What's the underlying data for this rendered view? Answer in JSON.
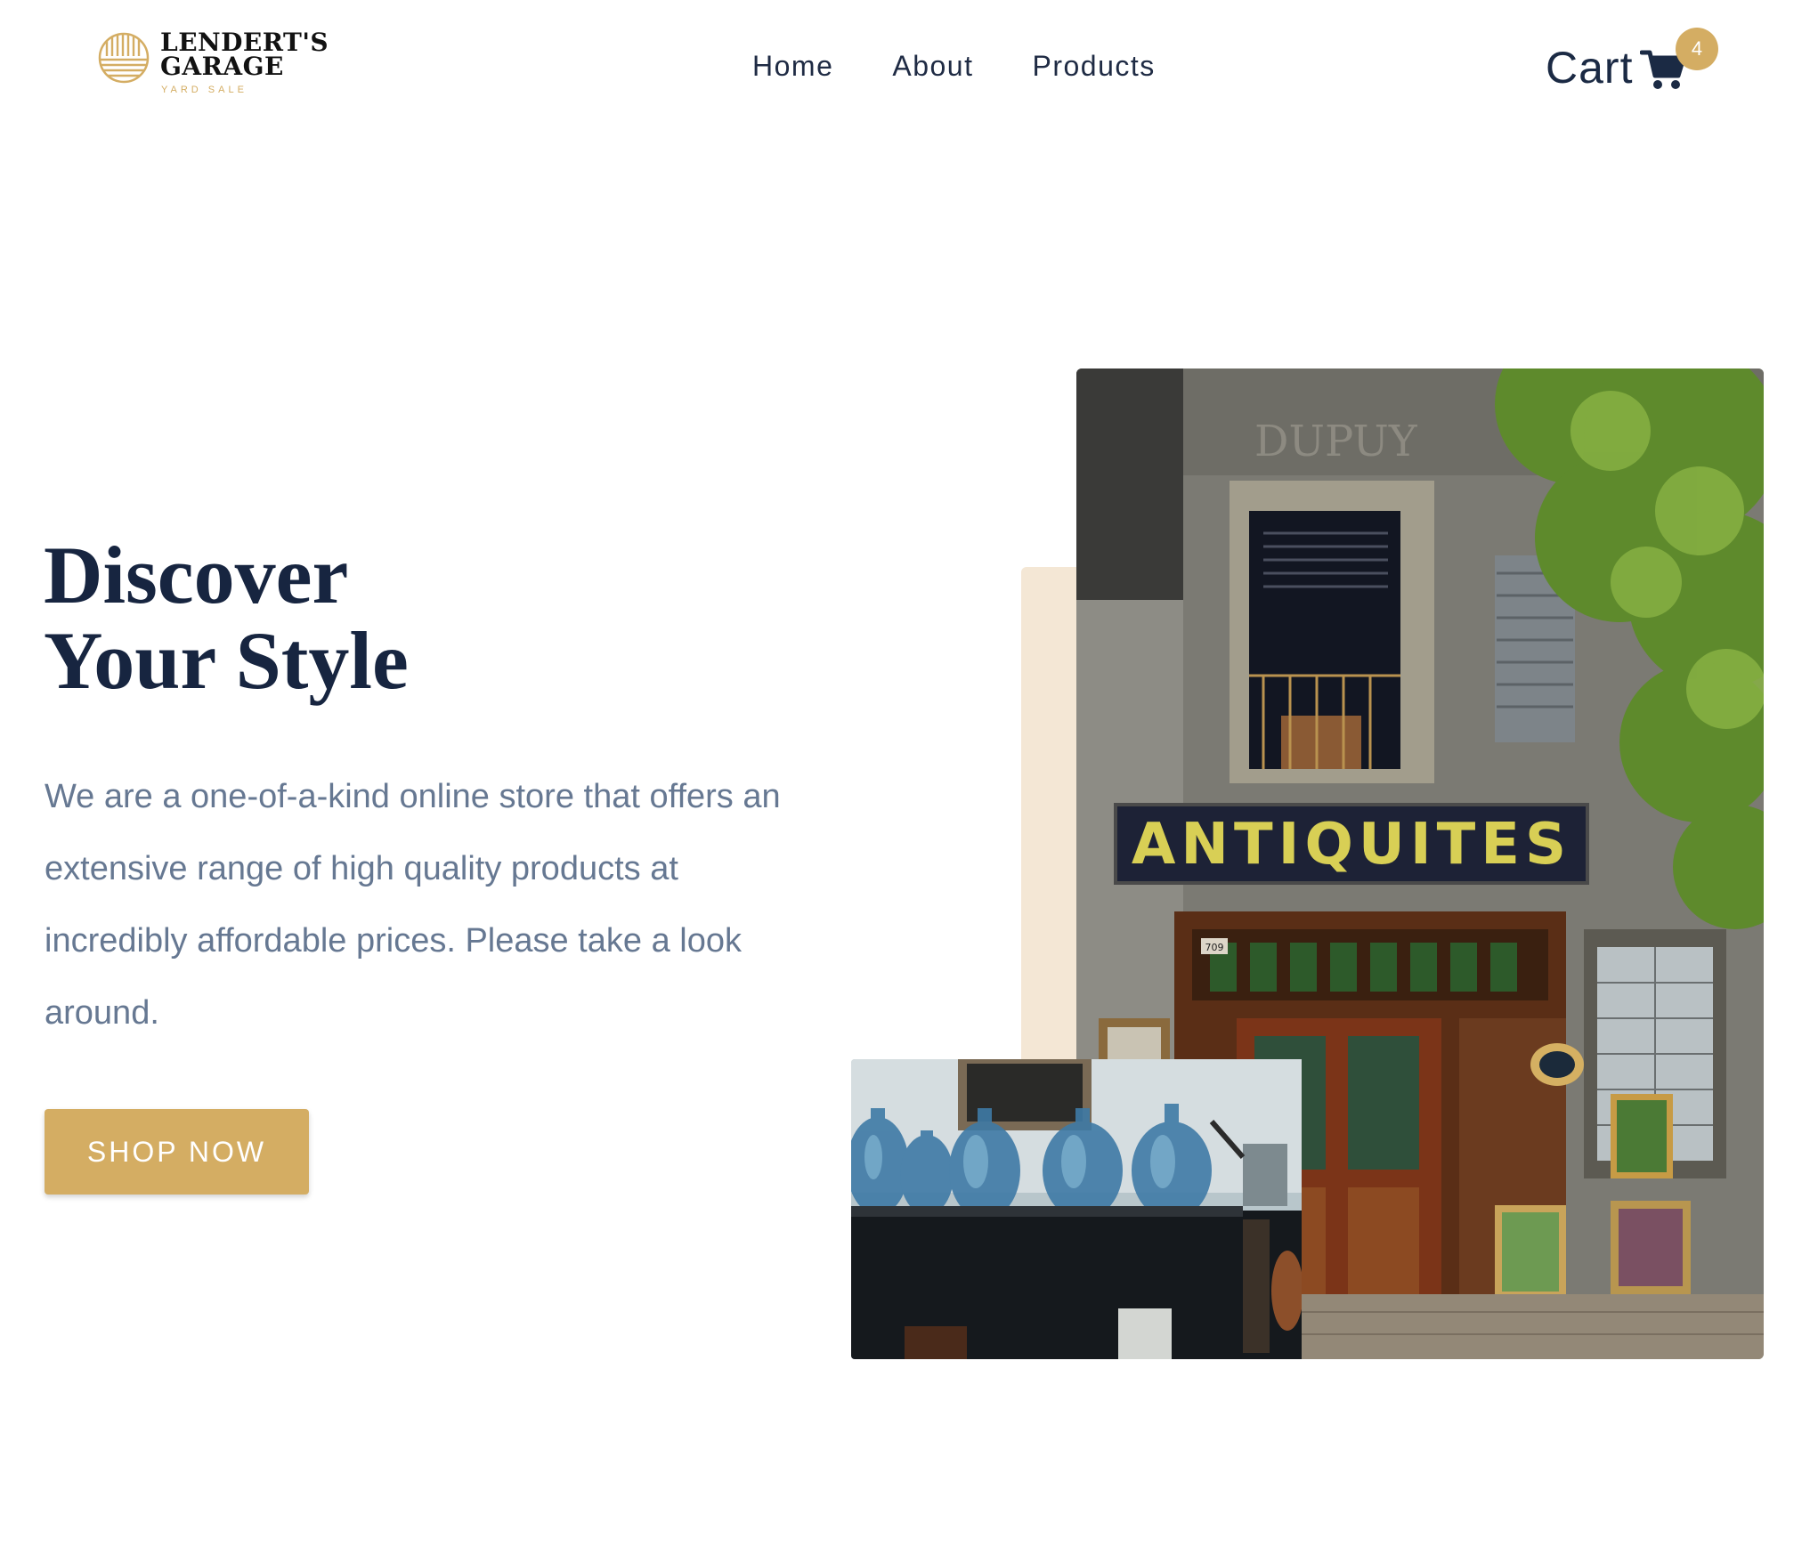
{
  "header": {
    "logo": {
      "name_line1": "LENDERT'S",
      "name_line2": "GARAGE",
      "tagline": "YARD SALE",
      "icon": "striped-circle-logo-icon"
    },
    "nav": [
      "Home",
      "About",
      "Products"
    ],
    "cart": {
      "label": "Cart",
      "icon": "shopping-cart-icon",
      "count": "4"
    }
  },
  "hero": {
    "title_line1": "Discover",
    "title_line2": "Your Style",
    "description": "We are a one-of-a-kind online store that offers an extensive range of high quality products at incredibly affordable prices. Please take a look around.",
    "cta_label": "SHOP NOW"
  },
  "images": {
    "main_photo": {
      "sign_text": "ANTIQUITES",
      "faded_wall_text": "DUPUY",
      "door_number": "709"
    },
    "secondary_photo": {}
  },
  "colors": {
    "accent_gold": "#d4ad63",
    "navy": "#172540",
    "body_text": "#667892",
    "beige_block": "#f4e7d5"
  }
}
